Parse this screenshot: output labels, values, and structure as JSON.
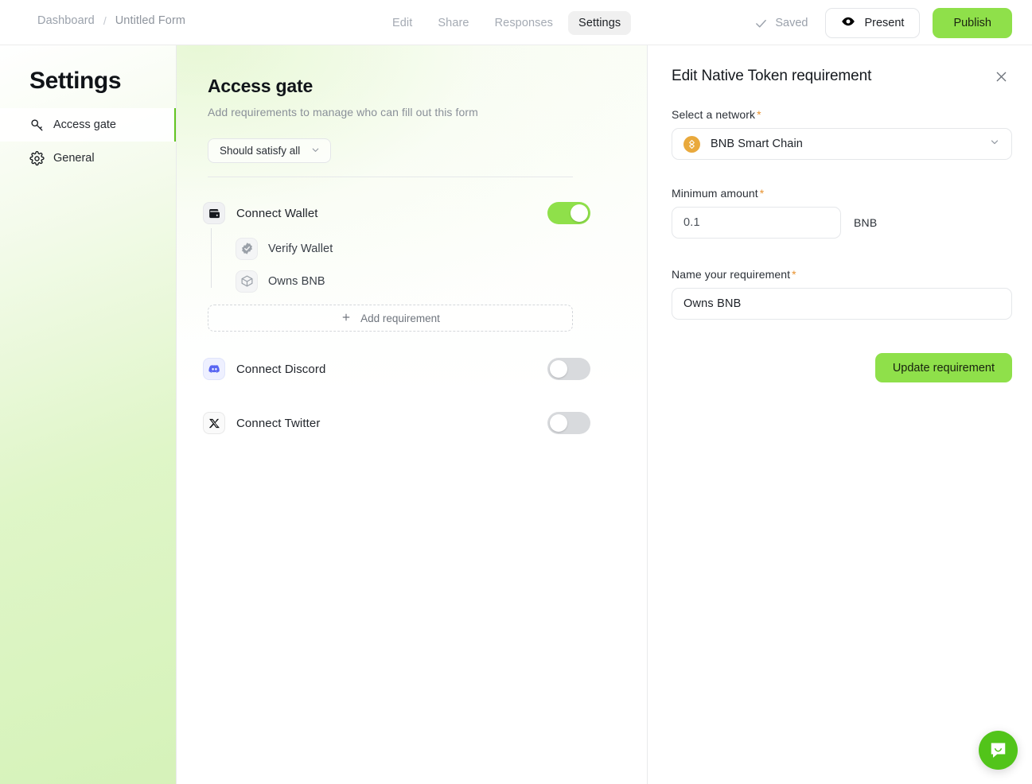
{
  "topbar": {
    "breadcrumb": {
      "root": "Dashboard",
      "separator": "/",
      "current": "Untitled Form"
    },
    "tabs": [
      {
        "label": "Edit",
        "active": false
      },
      {
        "label": "Share",
        "active": false
      },
      {
        "label": "Responses",
        "active": false
      },
      {
        "label": "Settings",
        "active": true
      }
    ],
    "saved_label": "Saved",
    "saved_icon": "check-icon",
    "present_label": "Present",
    "present_icon": "eye-icon",
    "publish_label": "Publish",
    "publish_color": "#8FE04A"
  },
  "sidebar": {
    "title": "Settings",
    "items": [
      {
        "label": "Access gate",
        "icon": "key-icon",
        "active": true
      },
      {
        "label": "General",
        "icon": "gear-icon",
        "active": false
      }
    ],
    "active_indicator_color": "#63C521"
  },
  "main": {
    "title": "Access gate",
    "subtitle": "Add requirements to manage who can fill out this form",
    "satisfy_select": {
      "value": "Should satisfy all",
      "icon": "chevron-down-icon"
    },
    "add_requirement_label": "Add requirement",
    "add_requirement_icon": "plus-icon",
    "groups": [
      {
        "label": "Connect Wallet",
        "icon": "wallet-icon",
        "enabled": true,
        "children": [
          {
            "label": "Verify Wallet",
            "icon": "verified-badge-icon"
          },
          {
            "label": "Owns BNB",
            "icon": "cube-icon"
          }
        ]
      },
      {
        "label": "Connect Discord",
        "icon": "discord-icon",
        "enabled": false,
        "children": []
      },
      {
        "label": "Connect Twitter",
        "icon": "twitter-x-icon",
        "enabled": false,
        "children": []
      }
    ]
  },
  "panel": {
    "title": "Edit Native Token requirement",
    "close_icon": "close-icon",
    "network_field": {
      "label": "Select a network",
      "required_marker": "*",
      "value": "BNB Smart Chain",
      "icon": "bnb-icon",
      "icon_color": "#E9A93C",
      "chevron": "chevron-down-icon"
    },
    "amount_field": {
      "label": "Minimum amount",
      "required_marker": "*",
      "value": "0.1",
      "unit": "BNB"
    },
    "name_field": {
      "label": "Name your requirement",
      "required_marker": "*",
      "value": "Owns BNB"
    },
    "submit_label": "Update requirement",
    "submit_color": "#8FE04A"
  },
  "chat": {
    "icon": "chat-bubble-icon",
    "color": "#52C41A"
  }
}
